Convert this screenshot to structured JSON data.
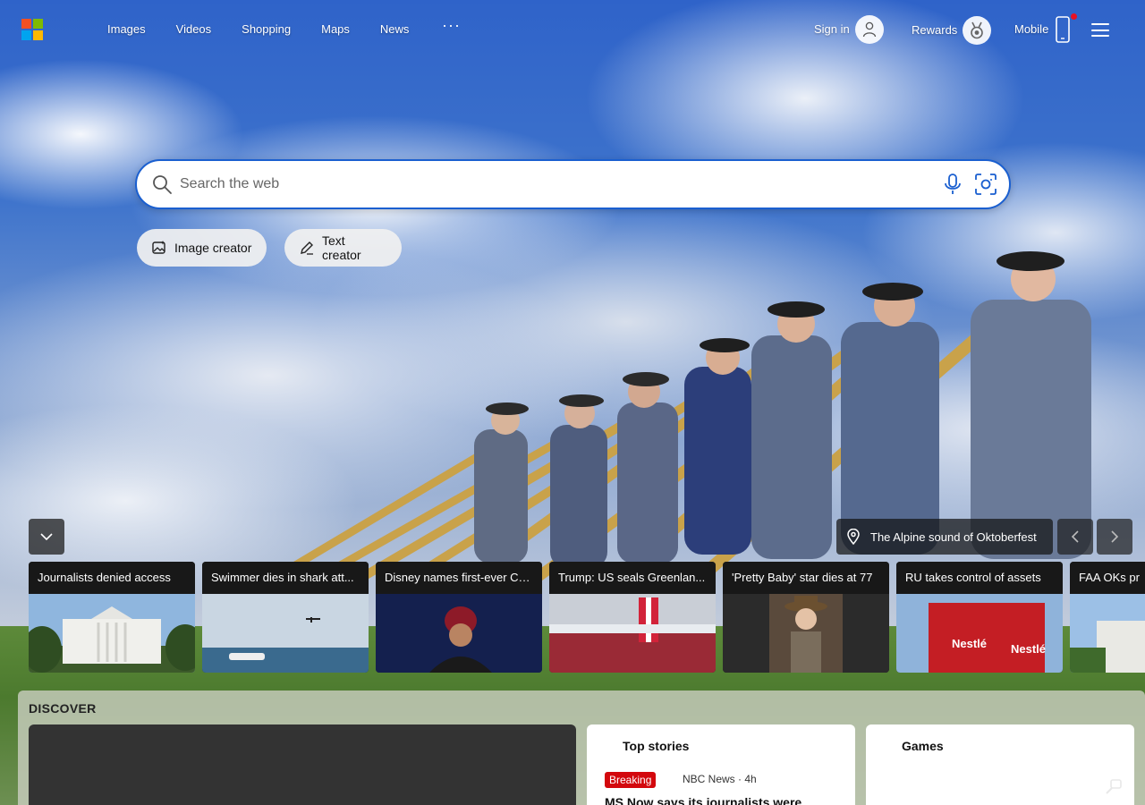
{
  "nav": {
    "links": [
      "Images",
      "Videos",
      "Shopping",
      "Maps",
      "News"
    ],
    "more": "···",
    "sign_in": "Sign in",
    "rewards": "Rewards",
    "mobile": "Mobile"
  },
  "search": {
    "placeholder": "Search the web"
  },
  "creators": {
    "image": "Image creator",
    "text": "Text creator"
  },
  "background_caption": "The Alpine sound of Oktoberfest",
  "news": [
    {
      "title": "Journalists denied access"
    },
    {
      "title": "Swimmer dies in shark att..."
    },
    {
      "title": "Disney names first-ever CTO"
    },
    {
      "title": "Trump: US seals Greenlan..."
    },
    {
      "title": "'Pretty Baby' star dies at 77"
    },
    {
      "title": "RU takes control of assets"
    },
    {
      "title": "FAA OKs pr"
    }
  ],
  "discover": {
    "title": "DISCOVER",
    "top_stories": {
      "title": "Top stories",
      "badge": "Breaking",
      "source": "NBC News · 4h",
      "headline": "MS Now says its journalists were"
    },
    "games": {
      "title": "Games"
    }
  },
  "icons": {
    "logo": "microsoft-logo-icon",
    "avatar": "user-icon",
    "rewards": "rewards-medal-icon",
    "mobile": "phone-icon",
    "menu": "hamburger-icon",
    "search": "search-icon",
    "mic": "microphone-icon",
    "visual_search": "camera-icon",
    "location": "location-pin-icon"
  },
  "colors": {
    "accent_border": "#1a5fd0",
    "badge_red": "#d3080d",
    "notification_dot": "#e81123"
  }
}
